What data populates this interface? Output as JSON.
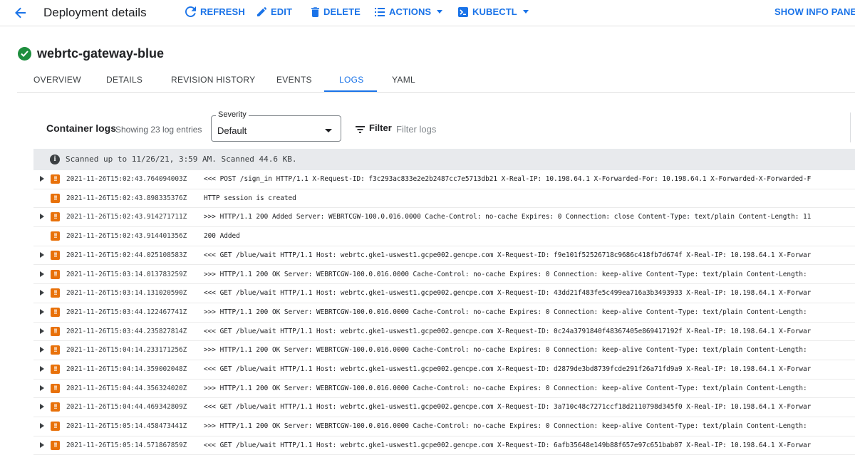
{
  "header": {
    "title": "Deployment details",
    "refresh": "REFRESH",
    "edit": "EDIT",
    "delete": "DELETE",
    "actions": "ACTIONS",
    "kubectl": "KUBECTL",
    "show_info_panel": "SHOW INFO PANEL",
    "accent_color": "#1a73e8"
  },
  "resource": {
    "name": "webrtc-gateway-blue",
    "status_color": "#1e8e3e"
  },
  "tabs": [
    {
      "label": "OVERVIEW"
    },
    {
      "label": "DETAILS"
    },
    {
      "label": "REVISION HISTORY"
    },
    {
      "label": "EVENTS"
    },
    {
      "label": "LOGS",
      "active": true
    },
    {
      "label": "YAML"
    }
  ],
  "logs": {
    "heading": "Container logs",
    "count_text": "Showing 23 log entries",
    "severity_label": "Severity",
    "severity_value": "Default",
    "filter_label": "Filter",
    "filter_placeholder": "Filter logs",
    "banner": "Scanned up to 11/26/21, 3:59 AM. Scanned 44.6 KB.",
    "severity_color": "#e8710a",
    "entries": [
      {
        "expandable": true,
        "timestamp": "2021-11-26T15:02:43.764094003Z",
        "message": "<<< POST /sign_in HTTP/1.1 X-Request-ID: f3c293ac833e2e2b2487cc7e5713db21 X-Real-IP: 10.198.64.1 X-Forwarded-For: 10.198.64.1 X-Forwarded-X-Forwarded-F"
      },
      {
        "expandable": false,
        "timestamp": "2021-11-26T15:02:43.898335376Z",
        "message": "HTTP session is created"
      },
      {
        "expandable": true,
        "timestamp": "2021-11-26T15:02:43.914271711Z",
        "message": ">>> HTTP/1.1 200 Added Server: WEBRTCGW-100.0.016.0000 Cache-Control: no-cache Expires: 0 Connection: close Content-Type: text/plain Content-Length: 11"
      },
      {
        "expandable": false,
        "timestamp": "2021-11-26T15:02:43.914401356Z",
        "message": "200 Added"
      },
      {
        "expandable": true,
        "timestamp": "2021-11-26T15:02:44.025108583Z",
        "message": "<<< GET /blue/wait HTTP/1.1 Host: webrtc.gke1-uswest1.gcpe002.gencpe.com X-Request-ID: f9e101f52526718c9686c418fb7d674f X-Real-IP: 10.198.64.1 X-Forwar"
      },
      {
        "expandable": true,
        "timestamp": "2021-11-26T15:03:14.013783259Z",
        "message": ">>> HTTP/1.1 200 OK Server: WEBRTCGW-100.0.016.0000 Cache-Control: no-cache Expires: 0 Connection: keep-alive Content-Type: text/plain Content-Length:"
      },
      {
        "expandable": true,
        "timestamp": "2021-11-26T15:03:14.131020590Z",
        "message": "<<< GET /blue/wait HTTP/1.1 Host: webrtc.gke1-uswest1.gcpe002.gencpe.com X-Request-ID: 43dd21f483fe5c499ea716a3b3493933 X-Real-IP: 10.198.64.1 X-Forwar"
      },
      {
        "expandable": true,
        "timestamp": "2021-11-26T15:03:44.122467741Z",
        "message": ">>> HTTP/1.1 200 OK Server: WEBRTCGW-100.0.016.0000 Cache-Control: no-cache Expires: 0 Connection: keep-alive Content-Type: text/plain Content-Length:"
      },
      {
        "expandable": true,
        "timestamp": "2021-11-26T15:03:44.235827814Z",
        "message": "<<< GET /blue/wait HTTP/1.1 Host: webrtc.gke1-uswest1.gcpe002.gencpe.com X-Request-ID: 0c24a3791840f48367405e869417192f X-Real-IP: 10.198.64.1 X-Forwar"
      },
      {
        "expandable": true,
        "timestamp": "2021-11-26T15:04:14.233171256Z",
        "message": ">>> HTTP/1.1 200 OK Server: WEBRTCGW-100.0.016.0000 Cache-Control: no-cache Expires: 0 Connection: keep-alive Content-Type: text/plain Content-Length:"
      },
      {
        "expandable": true,
        "timestamp": "2021-11-26T15:04:14.359002048Z",
        "message": "<<< GET /blue/wait HTTP/1.1 Host: webrtc.gke1-uswest1.gcpe002.gencpe.com X-Request-ID: d2879de3bd8739fcde291f26a71fd9a9 X-Real-IP: 10.198.64.1 X-Forwar"
      },
      {
        "expandable": true,
        "timestamp": "2021-11-26T15:04:44.356324020Z",
        "message": ">>> HTTP/1.1 200 OK Server: WEBRTCGW-100.0.016.0000 Cache-Control: no-cache Expires: 0 Connection: keep-alive Content-Type: text/plain Content-Length:"
      },
      {
        "expandable": true,
        "timestamp": "2021-11-26T15:04:44.469342809Z",
        "message": "<<< GET /blue/wait HTTP/1.1 Host: webrtc.gke1-uswest1.gcpe002.gencpe.com X-Request-ID: 3a710c48c7271ccf18d2110798d345f0 X-Real-IP: 10.198.64.1 X-Forwar"
      },
      {
        "expandable": true,
        "timestamp": "2021-11-26T15:05:14.458473441Z",
        "message": ">>> HTTP/1.1 200 OK Server: WEBRTCGW-100.0.016.0000 Cache-Control: no-cache Expires: 0 Connection: keep-alive Content-Type: text/plain Content-Length:"
      },
      {
        "expandable": true,
        "timestamp": "2021-11-26T15:05:14.571867859Z",
        "message": "<<< GET /blue/wait HTTP/1.1 Host: webrtc.gke1-uswest1.gcpe002.gencpe.com X-Request-ID: 6afb35648e149b88f657e97c651bab07 X-Real-IP: 10.198.64.1 X-Forwar"
      }
    ]
  }
}
